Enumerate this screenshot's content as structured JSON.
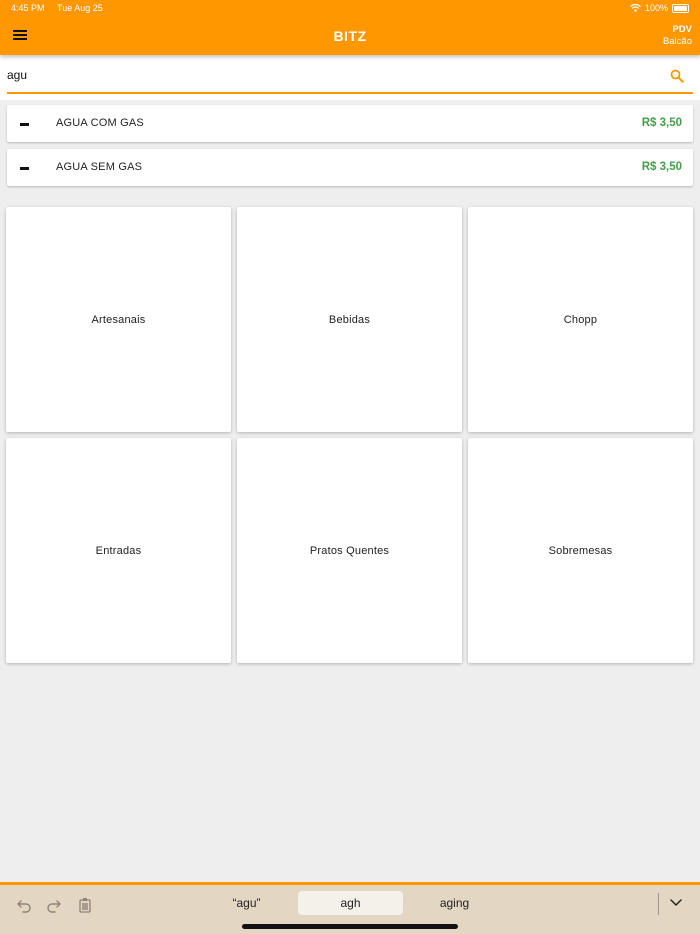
{
  "status": {
    "time": "4:45 PM",
    "date": "Tue Aug 25",
    "battery": "100%"
  },
  "header": {
    "title": "BITZ",
    "mode_line1": "PDV",
    "mode_line2": "Balcão"
  },
  "search": {
    "value": "agu",
    "placeholder": ""
  },
  "results": [
    {
      "name": "AGUA COM GAS",
      "price": "R$ 3,50"
    },
    {
      "name": "AGUA SEM GAS",
      "price": "R$ 3,50"
    }
  ],
  "categories": [
    "Artesanais",
    "Bebidas",
    "Chopp",
    "Entradas",
    "Pratos Quentes",
    "Sobremesas"
  ],
  "keyboard": {
    "suggestions": [
      "“agu”",
      "agh",
      "aging"
    ],
    "active_suggestion": 1
  },
  "colors": {
    "accent": "#ff9800",
    "price": "#43a047",
    "background": "#eeeeee",
    "keyboard_bar": "#e3d7c3"
  }
}
